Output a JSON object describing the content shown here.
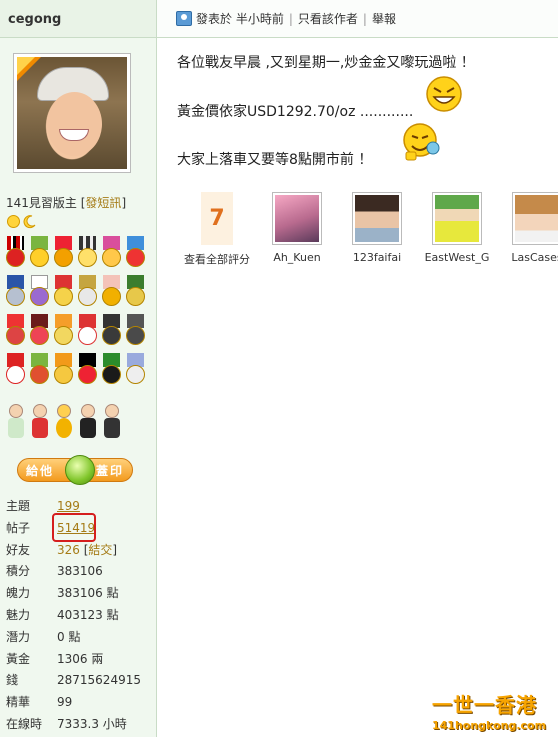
{
  "user": {
    "name": "cegong",
    "rank": "141見習版主",
    "send_pm": "發短訊"
  },
  "actions": {
    "gift_left": "給他",
    "gift_right": "蓋印"
  },
  "stats": [
    {
      "key": "主題",
      "value": "199",
      "link": true
    },
    {
      "key": "帖子",
      "value": "51419",
      "link": true
    },
    {
      "key": "好友",
      "value": "326",
      "link": true,
      "extra": "結交"
    },
    {
      "key": "積分",
      "value": "383106"
    },
    {
      "key": "魄力",
      "value": "383106 點"
    },
    {
      "key": "魅力",
      "value": "403123 點"
    },
    {
      "key": "潛力",
      "value": "0 點"
    },
    {
      "key": "黃金",
      "value": "1306 兩"
    },
    {
      "key": "錢",
      "value": "28715624915"
    },
    {
      "key": "精華",
      "value": "99"
    },
    {
      "key": "在線時",
      "value": "7333.3 小時"
    }
  ],
  "post_meta": {
    "posted": "發表於 半小時前",
    "author_only": "只看該作者",
    "report": "舉報"
  },
  "post": {
    "line1": "各位戰友早晨 ,又到星期一,炒金金又嚟玩過啦 ！",
    "line2": "黃金價依家USD1292.70/oz ............",
    "line3": "大家上落車又要等8點開市前 ！"
  },
  "ratings": {
    "count": "7",
    "view_all": "查看全部評分",
    "users": [
      "Ah_Kuen",
      "123faifai",
      "EastWest_G",
      "LasCases"
    ]
  },
  "watermark": {
    "line1": "一世一香港",
    "line2": "141hongkong.com"
  }
}
